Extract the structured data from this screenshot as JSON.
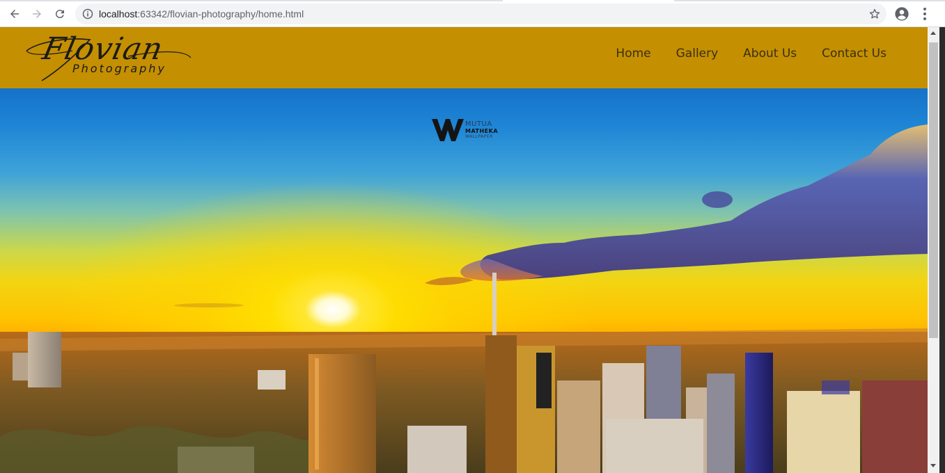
{
  "browser": {
    "url_host": "localhost",
    "url_rest": ":63342/flovian-photography/home.html",
    "icons": [
      "back-arrow-icon",
      "forward-arrow-icon",
      "reload-icon",
      "info-icon",
      "star-icon",
      "profile-icon",
      "kebab-menu-icon"
    ]
  },
  "site": {
    "logo": {
      "script": "Flovian",
      "sub": "Photography"
    },
    "nav": [
      {
        "label": "Home"
      },
      {
        "label": "Gallery"
      },
      {
        "label": "About Us"
      },
      {
        "label": "Contact Us"
      }
    ],
    "colors": {
      "header_bg": "#c48f01",
      "nav_text": "#3a2f12"
    }
  },
  "hero": {
    "watermark": {
      "line1": "MUTUA",
      "line2": "MATHEKA",
      "line3": "WALLPAPER"
    }
  }
}
